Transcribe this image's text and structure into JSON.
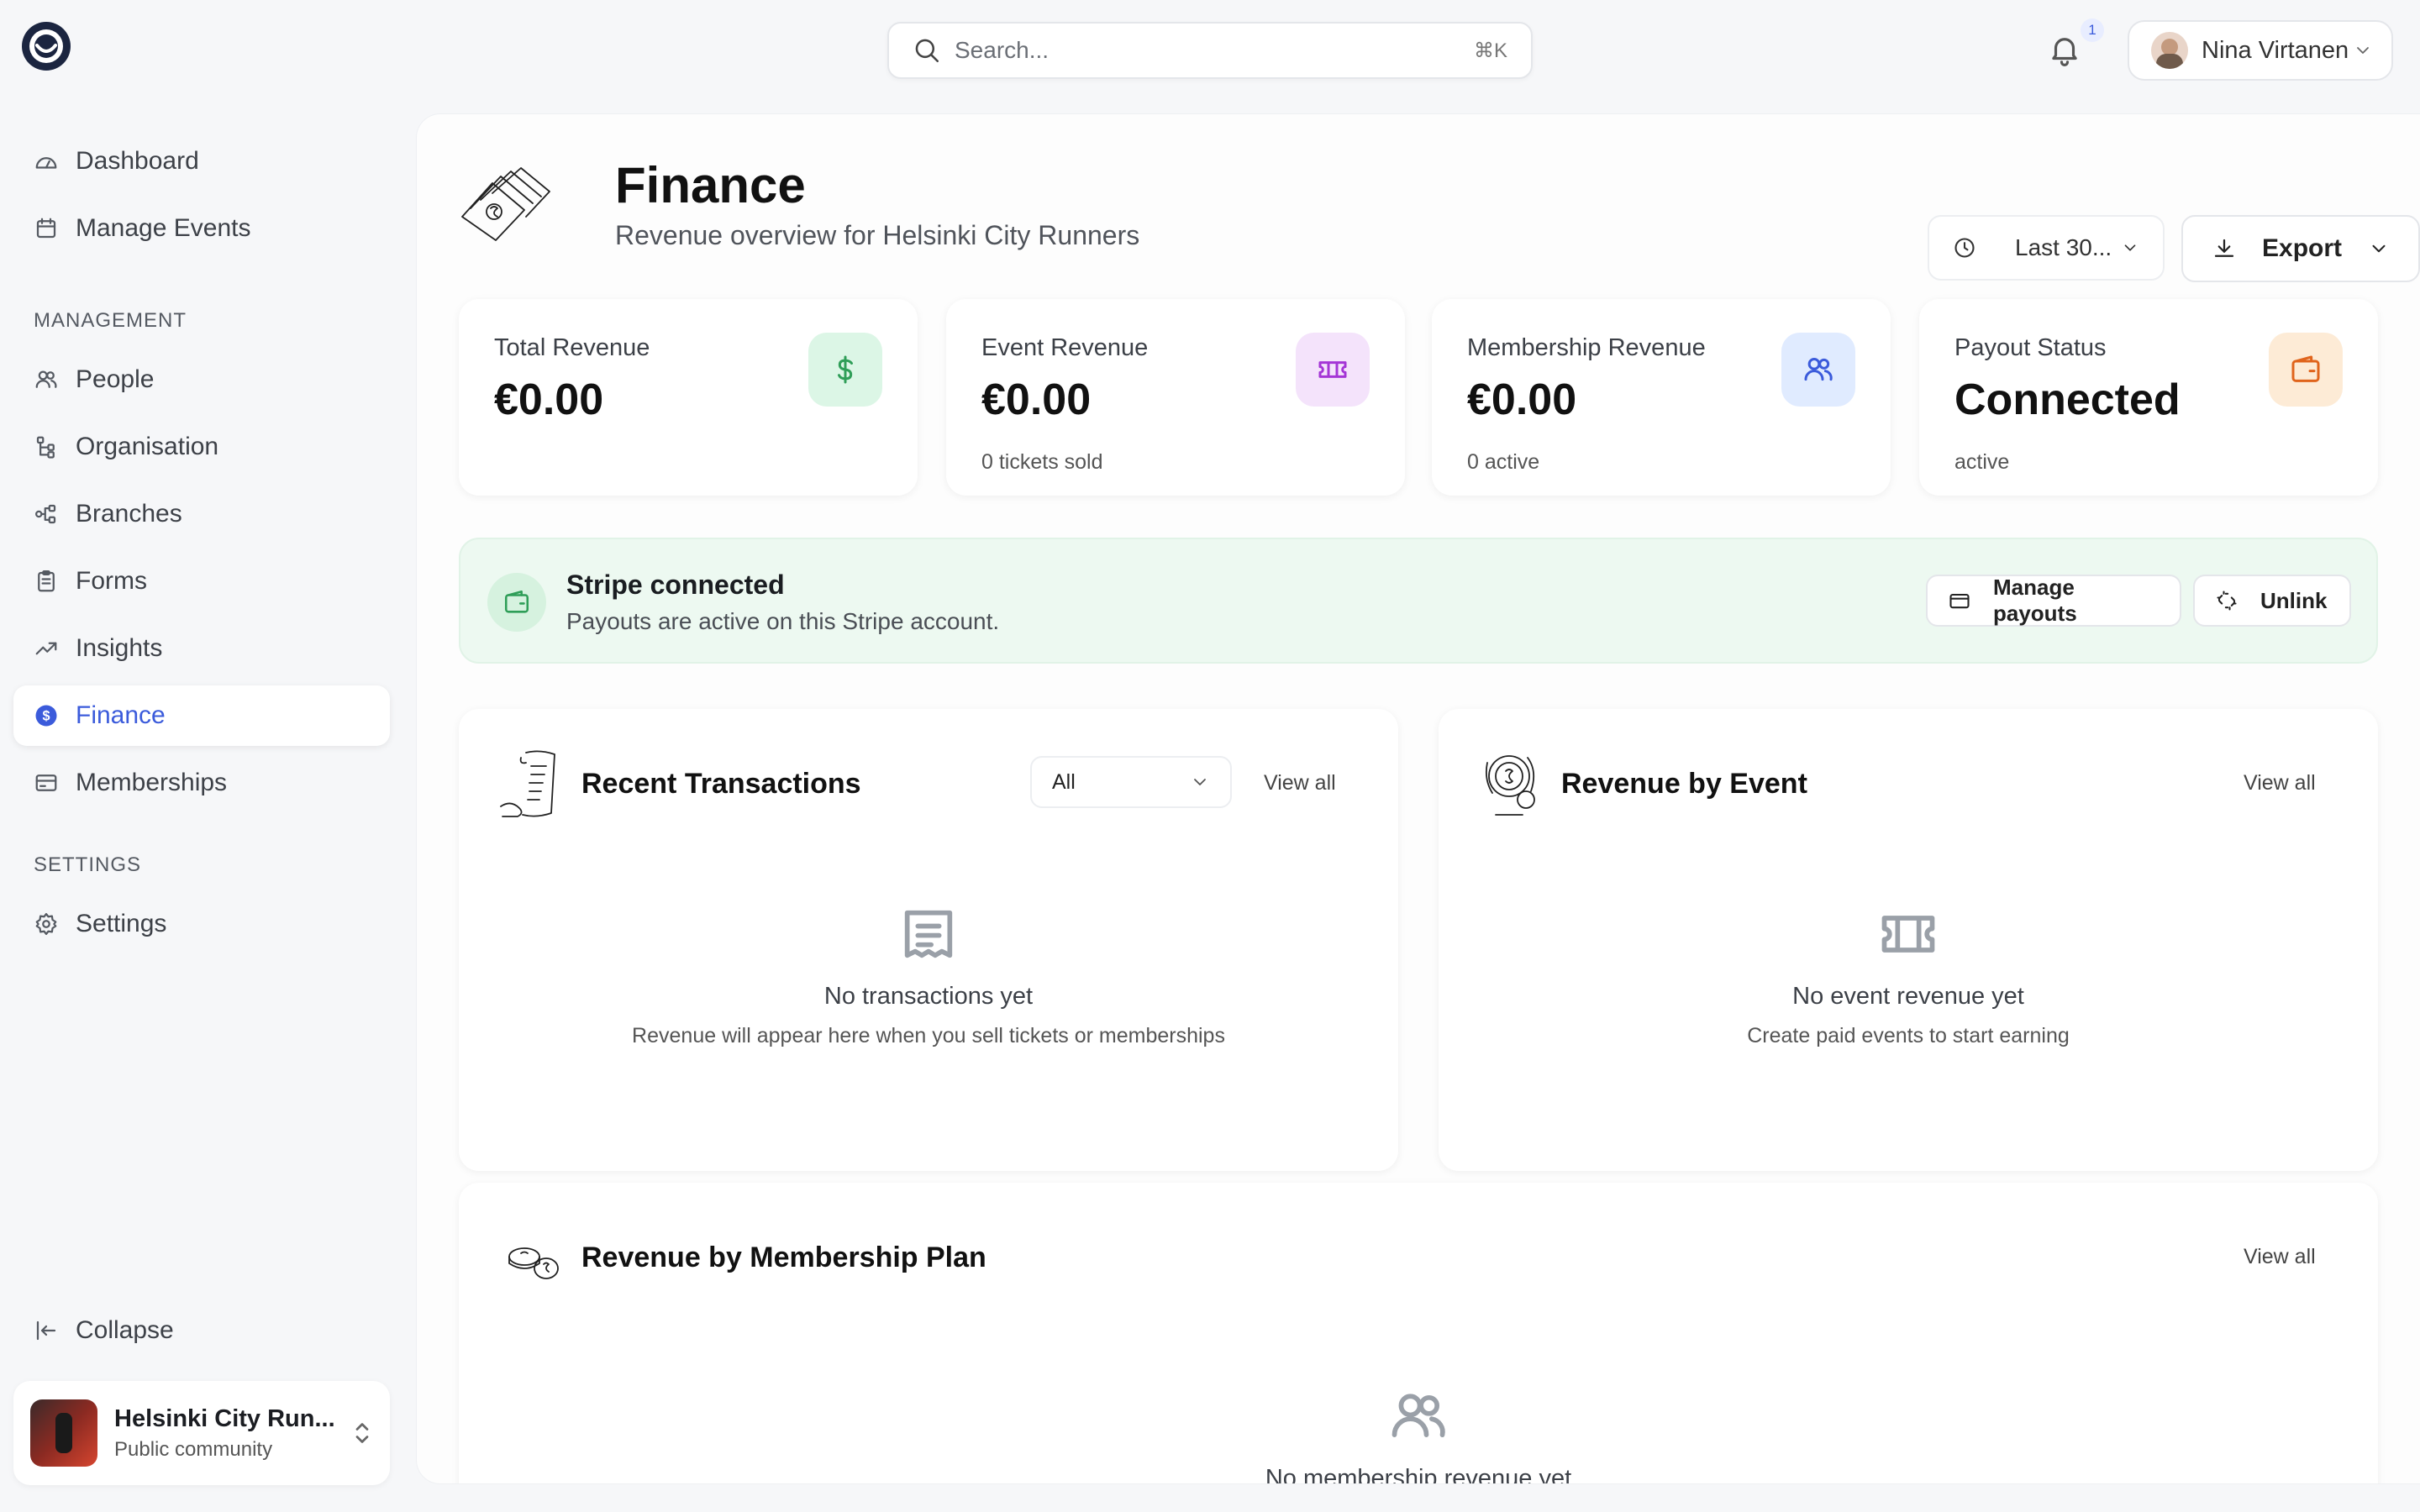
{
  "topbar": {
    "search_placeholder": "Search...",
    "search_shortcut": "⌘K",
    "notification_count": "1",
    "user_name": "Nina Virtanen"
  },
  "sidebar": {
    "top_items": [
      {
        "label": "Dashboard",
        "icon": "gauge-icon"
      },
      {
        "label": "Manage Events",
        "icon": "calendar-icon"
      }
    ],
    "management_label": "MANAGEMENT",
    "management_items": [
      {
        "label": "People",
        "icon": "users-icon"
      },
      {
        "label": "Organisation",
        "icon": "org-tree-icon"
      },
      {
        "label": "Branches",
        "icon": "branches-icon"
      },
      {
        "label": "Forms",
        "icon": "clipboard-icon"
      },
      {
        "label": "Insights",
        "icon": "trending-up-icon"
      },
      {
        "label": "Finance",
        "icon": "dollar-circle-icon",
        "active": true
      },
      {
        "label": "Memberships",
        "icon": "card-icon"
      }
    ],
    "settings_label": "SETTINGS",
    "settings_items": [
      {
        "label": "Settings",
        "icon": "gear-icon"
      }
    ],
    "collapse_label": "Collapse",
    "community": {
      "name": "Helsinki City Run...",
      "type": "Public community"
    }
  },
  "page": {
    "title": "Finance",
    "subtitle": "Revenue overview for Helsinki City Runners",
    "range_label": "Last 30...",
    "export_label": "Export"
  },
  "stats": [
    {
      "label": "Total Revenue",
      "value": "€0.00",
      "sub": "",
      "icon": "dollar-icon",
      "bg": "#dcf6e6",
      "fg": "#2f9e58"
    },
    {
      "label": "Event Revenue",
      "value": "€0.00",
      "sub": "0 tickets sold",
      "icon": "ticket-icon",
      "bg": "#f4e3fb",
      "fg": "#a435d6"
    },
    {
      "label": "Membership Revenue",
      "value": "€0.00",
      "sub": "0 active",
      "icon": "users-icon",
      "bg": "#e0ebff",
      "fg": "#3b5bdb"
    },
    {
      "label": "Payout Status",
      "value": "Connected",
      "sub": "active",
      "icon": "wallet-icon",
      "bg": "#fdebd6",
      "fg": "#e0641c"
    }
  ],
  "stripe": {
    "title": "Stripe connected",
    "subtitle": "Payouts are active on this Stripe account.",
    "manage_label": "Manage payouts",
    "unlink_label": "Unlink"
  },
  "transactions": {
    "title": "Recent Transactions",
    "filter_value": "All",
    "view_all": "View all",
    "empty_title": "No transactions yet",
    "empty_sub": "Revenue will appear here when you sell tickets or memberships"
  },
  "revenue_by_event": {
    "title": "Revenue by Event",
    "view_all": "View all",
    "empty_title": "No event revenue yet",
    "empty_sub": "Create paid events to start earning"
  },
  "revenue_by_plan": {
    "title": "Revenue by Membership Plan",
    "view_all": "View all",
    "empty_title": "No membership revenue yet"
  }
}
